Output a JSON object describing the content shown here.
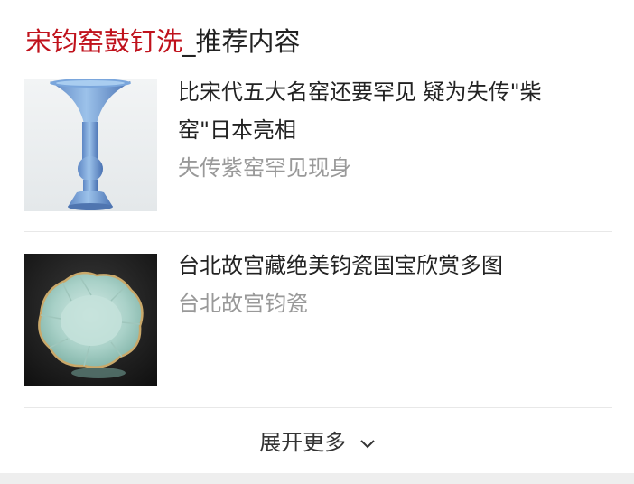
{
  "header": {
    "keyword": "宋钧窑鼓钉洗",
    "separator": "_",
    "subtitle": "推荐内容",
    "keyword_color": "#c0121c"
  },
  "items": [
    {
      "title": "比宋代五大名窑还要罕见 疑为失传\"柴窑\"日本亮相",
      "source": "失传紫窑罕见现身",
      "thumbnail": "blue-glazed-vase-image"
    },
    {
      "title": "台北故宫藏绝美钧瓷国宝欣赏多图",
      "source": "台北故宫钧瓷",
      "thumbnail": "celadon-lobed-bowl-image"
    }
  ],
  "more": {
    "label": "展开更多",
    "icon": "chevron-down-icon"
  }
}
